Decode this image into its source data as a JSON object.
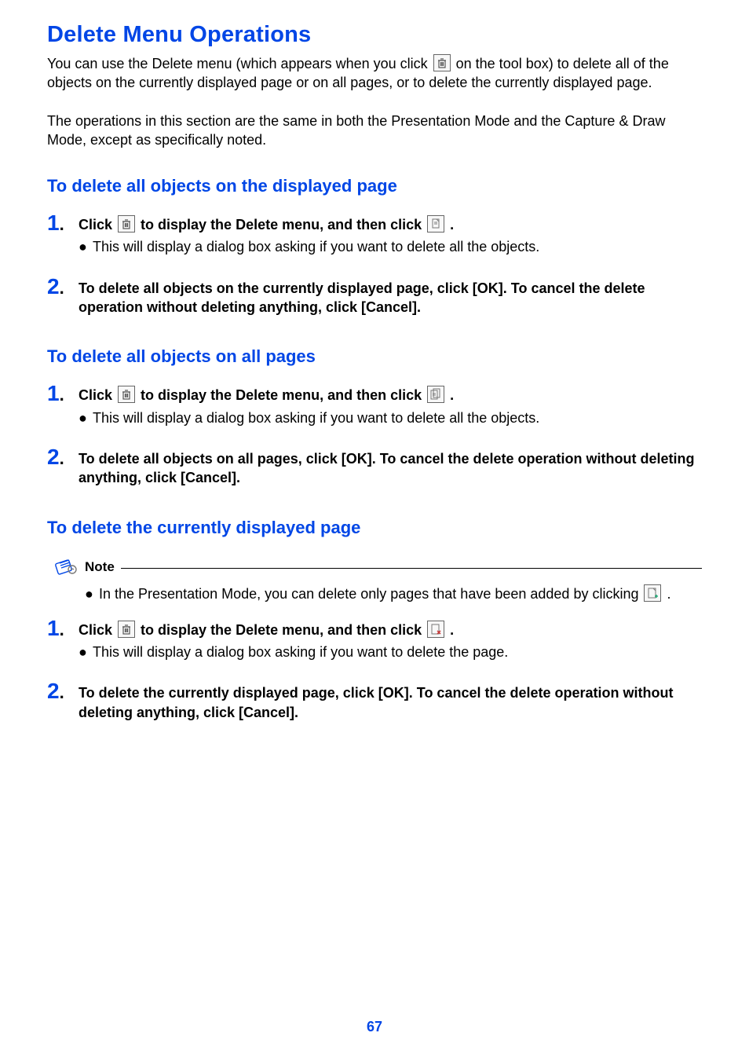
{
  "title": "Delete Menu Operations",
  "intro_part1": "You can use the Delete menu (which appears when you click ",
  "intro_part2": " on the tool box) to delete all of the objects on the currently displayed page or on all pages, or to delete the currently displayed page.",
  "intro2": "The operations in this section are the same in both the Presentation Mode and the Capture & Draw Mode, except as specifically noted.",
  "sections": [
    {
      "heading": "To delete all objects on the displayed page",
      "steps": [
        {
          "num": "1",
          "main_a": "Click ",
          "main_b": " to display the Delete menu, and then click ",
          "main_c": ".",
          "bullet": "This will display a dialog box asking if you want to delete all the objects."
        },
        {
          "num": "2",
          "main": "To delete all objects on the currently displayed page, click [OK]. To cancel the delete operation without deleting anything, click [Cancel]."
        }
      ]
    },
    {
      "heading": "To delete all objects on all pages",
      "steps": [
        {
          "num": "1",
          "main_a": "Click ",
          "main_b": " to display the Delete menu, and then click ",
          "main_c": ".",
          "bullet": "This will display a dialog box asking if you want to delete all the objects."
        },
        {
          "num": "2",
          "main": "To delete all objects on all pages, click [OK]. To cancel the delete operation without deleting anything, click [Cancel]."
        }
      ]
    },
    {
      "heading": "To delete the currently displayed page",
      "note_label": "Note",
      "note_a": "In the Presentation Mode, you can delete only pages that have been added by clicking ",
      "note_b": ".",
      "steps": [
        {
          "num": "1",
          "main_a": "Click ",
          "main_b": " to display the Delete menu, and then click ",
          "main_c": ".",
          "bullet": "This will display a dialog box asking if you want to delete the page."
        },
        {
          "num": "2",
          "main": "To delete the currently displayed page, click [OK]. To cancel the delete operation without deleting anything, click [Cancel]."
        }
      ]
    }
  ],
  "page_number": "67"
}
